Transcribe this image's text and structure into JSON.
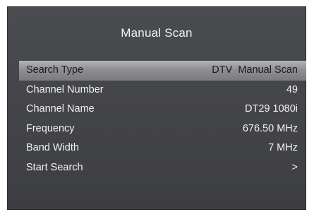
{
  "menu": {
    "title": "Manual Scan",
    "items": [
      {
        "label": "Search Type",
        "value": "DTV  Manual Scan"
      },
      {
        "label": "Channel Number",
        "value": "49"
      },
      {
        "label": "Channel Name",
        "value": "DT29 1080i"
      },
      {
        "label": "Frequency",
        "value": "676.50 MHz"
      },
      {
        "label": "Band Width",
        "value": "7 MHz"
      },
      {
        "label": "Start Search",
        "value": ">"
      }
    ],
    "selected_index": 0
  },
  "colors": {
    "panel_bg": "#454649",
    "text": "#f2f2f2",
    "highlight": "#9a9b9e"
  }
}
